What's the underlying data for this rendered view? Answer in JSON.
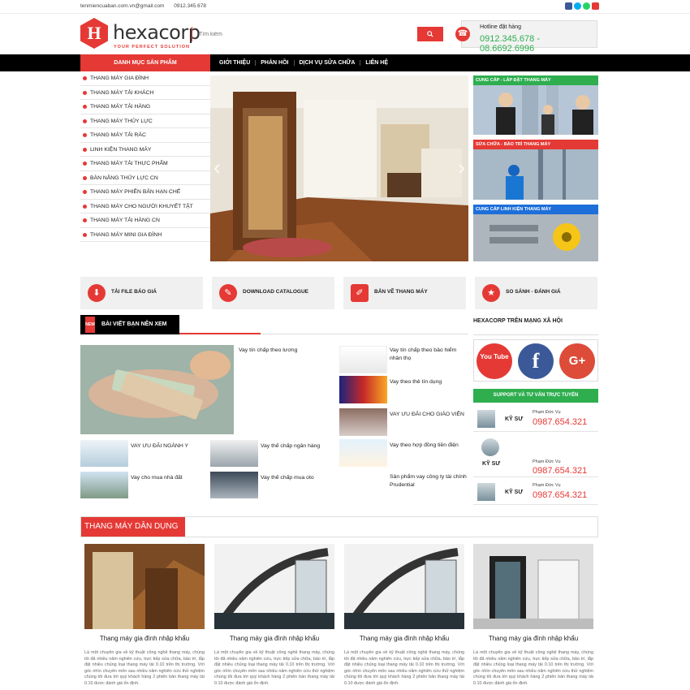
{
  "topbar": {
    "email": "tenmiencuaban.com.vn@gmail.com",
    "phone": "0912.345.678",
    "social_icons": [
      "facebook-icon",
      "skype-icon",
      "whatsapp-icon",
      "youtube-icon"
    ]
  },
  "header": {
    "logo_letter": "H",
    "logo_name": "hexacorp",
    "logo_tagline": "YOUR PERFECT SOLUTION",
    "search_placeholder": "Tìm kiếm",
    "hotline_label": "Hotline đặt hàng",
    "hotline_numbers": "0912.345.678 - 08.6692.6996"
  },
  "nav": {
    "category_label": "DANH MỤC SẢN PHẨM",
    "menu": [
      "GIỚI THIỆU",
      "PHẢN HỒI",
      "DỊCH VỤ SỬA CHỮA",
      "LIÊN HỆ"
    ]
  },
  "sidebar": {
    "items": [
      "THANG MÁY GIA ĐÌNH",
      "THANG MÁY TẢI KHÁCH",
      "THANG MÁY TẢI HÀNG",
      "THANG MÁY THỦY LỰC",
      "THANG MÁY TẢI RÁC",
      "LINH KIỆN THANG MÁY",
      "THANG MÁY TẢI THỰC PHẨM",
      "BÀN NÂNG THỦY LỰC CN",
      "THANG MÁY PHIÊN BẢN HẠN CHẾ",
      "THANG MÁY CHO NGƯỜI KHUYẾT TẬT",
      "THANG MÁY TẢI HÀNG CN",
      "THANG MÁY MINI GIA ĐÌNH"
    ]
  },
  "promos": [
    {
      "label": "CUNG CẤP - LẮP ĐẶT THANG MÁY",
      "color": "#2eae4f"
    },
    {
      "label": "SỬA CHỮA - BẢO TRÌ THANG MÁY",
      "color": "#e53935"
    },
    {
      "label": "CUNG CẤP LINH KIỆN THANG MÁY",
      "color": "#1e6fd9"
    }
  ],
  "features": [
    {
      "label": "TẢI FILE BÁO GIÁ",
      "icon": "download-icon"
    },
    {
      "label": "DOWNLOAD CATALOGUE",
      "icon": "catalogue-icon"
    },
    {
      "label": "BẢN VẼ THANG MÁY",
      "icon": "drawing-icon"
    },
    {
      "label": "SO SÁNH - ĐÁNH GIÁ",
      "icon": "compare-icon"
    }
  ],
  "articles": {
    "section_title": "BÀI VIẾT BẠN NÊN XEM",
    "section_badge": "NEW",
    "featured": "Vay tín chấp theo lương",
    "small_left": [
      "VAY ƯU ĐÃI NGÀNH Y",
      "Vay thế chấp ngân hàng",
      "Vay cho mua nhà đất",
      "Vay thế chấp mua oto"
    ],
    "right": [
      "Vay tín chấp theo bảo hiểm nhân thọ",
      "Vay theo thẻ tín dụng",
      "VAY ƯU ĐÃI CHO GIÁO VIÊN",
      "Vay theo hợp đồng tiền điện",
      "Sản phẩm vay công ty tài chính Prudential"
    ]
  },
  "right_col": {
    "social_title": "HEXACORP TRÊN MẠNG XÃ HỘI",
    "social": [
      "You Tube",
      "f",
      "G+"
    ],
    "support_title": "SUPPORT VÀ TƯ VẤN TRỰC TUYẾN",
    "supporters": [
      {
        "role": "KỸ SƯ",
        "name": "Phạm Đức Vụ",
        "phone": "0987.654.321"
      },
      {
        "role": "KỸ SƯ",
        "name": "Phạm Đức Vụ",
        "phone": "0987.654.321"
      },
      {
        "role": "KỸ SƯ",
        "name": "Phạm Đức Vụ",
        "phone": "0987.654.321"
      }
    ]
  },
  "products": {
    "section_title": "THANG MÁY DÂN DỤNG",
    "items": [
      {
        "title": "Thang máy gia đình nhập khẩu",
        "desc": "Là một chuyên gia về kỹ thuật công nghệ thang máy, chúng tôi đã nhiều năm nghiên cứu, trực tiếp sửa chữa, bảo trì, lắp đặt nhiều chủng loại thang máy tải 0.10 trên thị trường. Với góc nhìn chuyên môn sau nhiều năm nghiên cứu thử nghiệm chúng tôi đưa tới quý khách hàng 2 phiên bản thang máy tải 0.10 được đánh giá ổn định."
      },
      {
        "title": "Thang máy gia đình nhập khẩu",
        "desc": "Là một chuyên gia về kỹ thuật công nghệ thang máy, chúng tôi đã nhiều năm nghiên cứu, trực tiếp sửa chữa, bảo trì, lắp đặt nhiều chủng loại thang máy tải 0.10 trên thị trường. Với góc nhìn chuyên môn sau nhiều năm nghiên cứu thử nghiệm chúng tôi đưa tới quý khách hàng 2 phiên bản thang máy tải 0.10 được đánh giá ổn định."
      },
      {
        "title": "Thang máy gia đình nhập khẩu",
        "desc": "Là một chuyên gia về kỹ thuật công nghệ thang máy, chúng tôi đã nhiều năm nghiên cứu, trực tiếp sửa chữa, bảo trì, lắp đặt nhiều chủng loại thang máy tải 0.10 trên thị trường. Với góc nhìn chuyên môn sau nhiều năm nghiên cứu thử nghiệm chúng tôi đưa tới quý khách hàng 2 phiên bản thang máy tải 0.10 được đánh giá ổn định."
      },
      {
        "title": "Thang máy gia đình nhập khẩu",
        "desc": "Là một chuyên gia về kỹ thuật công nghệ thang máy, chúng tôi đã nhiều năm nghiên cứu, trực tiếp sửa chữa, bảo trì, lắp đặt nhiều chủng loại thang máy tải 0.10 trên thị trường. Với góc nhìn chuyên môn sau nhiều năm nghiên cứu thử nghiệm chúng tôi đưa tới quý khách hàng 2 phiên bản thang máy tải 0.10 được đánh giá ổn định."
      }
    ]
  },
  "colors": {
    "accent": "#e53935",
    "green": "#2eae4f",
    "blue": "#1e6fd9",
    "nav": "#000000"
  }
}
